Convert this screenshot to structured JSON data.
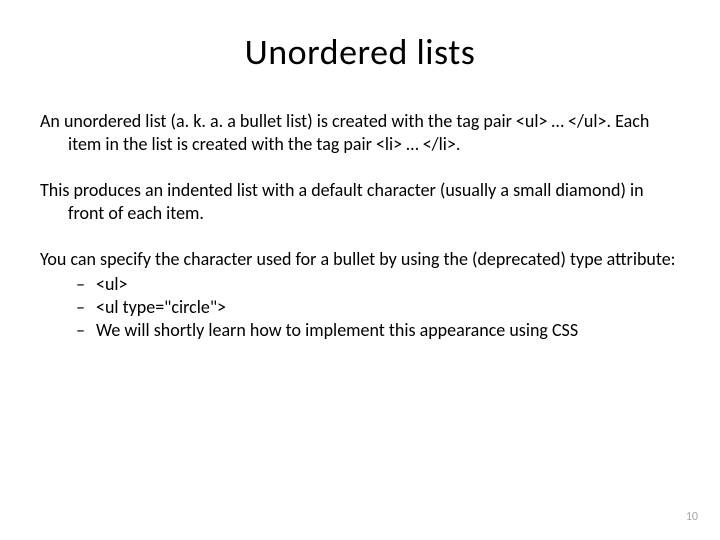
{
  "slide": {
    "title": "Unordered lists",
    "para1": "An unordered list (a. k. a. a bullet list) is created with the  tag pair <ul> … </ul>.  Each item in the list is created with the tag pair <li> … </li>.",
    "para2": "This produces an indented list with a default character (usually a small diamond) in front of each item.",
    "para3_lead": "You can specify the character used for a bullet by using the (deprecated) type attribute:",
    "bullets": [
      "<ul>",
      "<ul type=\"circle\">",
      "We will shortly learn how to implement this appearance using CSS"
    ],
    "page_number": "10"
  }
}
